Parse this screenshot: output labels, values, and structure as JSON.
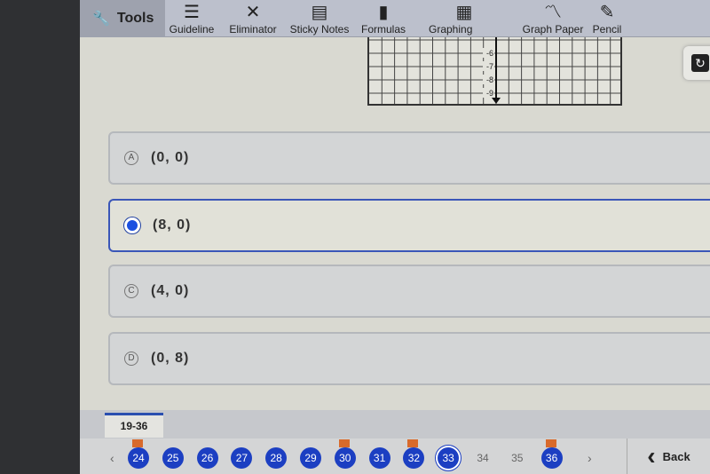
{
  "toolbar": {
    "tools_label": "Tools",
    "items": [
      {
        "label": "Guideline",
        "icon": "guideline-icon",
        "glyph": "☰"
      },
      {
        "label": "Eliminator",
        "icon": "x-icon",
        "glyph": "✕"
      },
      {
        "label": "Sticky Notes",
        "icon": "note-icon",
        "glyph": "▤"
      },
      {
        "label": "Formulas",
        "icon": "books-icon",
        "glyph": "▮"
      },
      {
        "label": "Graphing Calculator",
        "icon": "calculator-icon",
        "glyph": "▦"
      },
      {
        "label": "Graph Paper",
        "icon": "graph-line-icon",
        "glyph": "〽"
      },
      {
        "label": "Pencil",
        "icon": "pencil-icon",
        "glyph": "✎"
      }
    ]
  },
  "graph": {
    "y_labels": [
      "-6",
      "-7",
      "-8",
      "-9"
    ]
  },
  "choices": [
    {
      "letter": "A",
      "value": "(0, 0)",
      "selected": false
    },
    {
      "letter": "B",
      "value": "(8, 0)",
      "selected": true
    },
    {
      "letter": "C",
      "value": "(4, 0)",
      "selected": false
    },
    {
      "letter": "D",
      "value": "(0, 8)",
      "selected": false
    }
  ],
  "nav": {
    "range": "19-36",
    "back_label": "Back",
    "prev": "‹",
    "next": "›",
    "questions": [
      {
        "n": "24",
        "answered": true,
        "flagged": true
      },
      {
        "n": "25",
        "answered": true,
        "flagged": false
      },
      {
        "n": "26",
        "answered": true,
        "flagged": false
      },
      {
        "n": "27",
        "answered": true,
        "flagged": false
      },
      {
        "n": "28",
        "answered": true,
        "flagged": false
      },
      {
        "n": "29",
        "answered": true,
        "flagged": false
      },
      {
        "n": "30",
        "answered": true,
        "flagged": true
      },
      {
        "n": "31",
        "answered": true,
        "flagged": false
      },
      {
        "n": "32",
        "answered": true,
        "flagged": true
      },
      {
        "n": "33",
        "answered": true,
        "flagged": false,
        "current": true
      },
      {
        "n": "34",
        "answered": false,
        "flagged": false
      },
      {
        "n": "35",
        "answered": false,
        "flagged": false
      },
      {
        "n": "36",
        "answered": true,
        "flagged": true
      }
    ]
  }
}
